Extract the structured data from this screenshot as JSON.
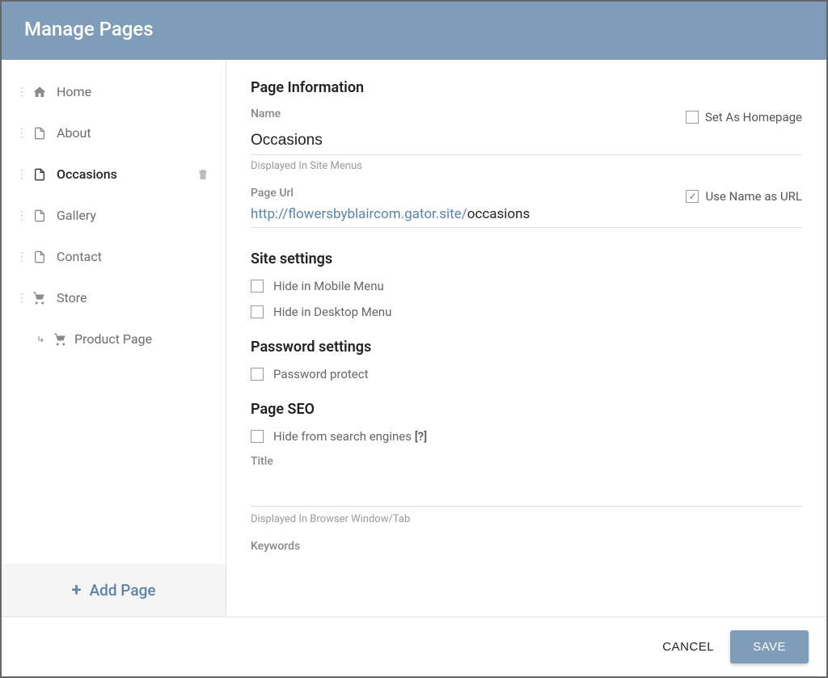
{
  "header": {
    "title": "Manage Pages"
  },
  "sidebar": {
    "items": [
      {
        "label": "Home",
        "icon": "home-icon"
      },
      {
        "label": "About",
        "icon": "page-icon"
      },
      {
        "label": "Occasions",
        "icon": "page-icon",
        "active": true
      },
      {
        "label": "Gallery",
        "icon": "page-icon"
      },
      {
        "label": "Contact",
        "icon": "page-icon"
      },
      {
        "label": "Store",
        "icon": "cart-icon"
      }
    ],
    "child": {
      "label": "Product Page",
      "icon": "cart-icon"
    },
    "add_page_label": "Add Page"
  },
  "main": {
    "page_information_heading": "Page Information",
    "name_label": "Name",
    "name_value": "Occasions",
    "set_as_homepage_label": "Set As Homepage",
    "set_as_homepage_checked": false,
    "displayed_in_menus_hint": "Displayed In Site Menus",
    "page_url_label": "Page Url",
    "use_name_as_url_label": "Use Name as URL",
    "use_name_as_url_checked": true,
    "url_base": "http://flowersbyblaircom.gator.site/",
    "url_slug": "occasions",
    "site_settings_heading": "Site settings",
    "hide_mobile_label": "Hide in Mobile Menu",
    "hide_mobile_checked": false,
    "hide_desktop_label": "Hide in Desktop Menu",
    "hide_desktop_checked": false,
    "password_settings_heading": "Password settings",
    "password_protect_label": "Password protect",
    "password_protect_checked": false,
    "page_seo_heading": "Page SEO",
    "hide_search_label": "Hide from search engines",
    "hide_search_help": "[?]",
    "hide_search_checked": false,
    "seo_title_label": "Title",
    "seo_title_value": "",
    "displayed_in_tab_hint": "Displayed In Browser Window/Tab",
    "keywords_label": "Keywords"
  },
  "footer": {
    "cancel_label": "CANCEL",
    "save_label": "SAVE"
  }
}
